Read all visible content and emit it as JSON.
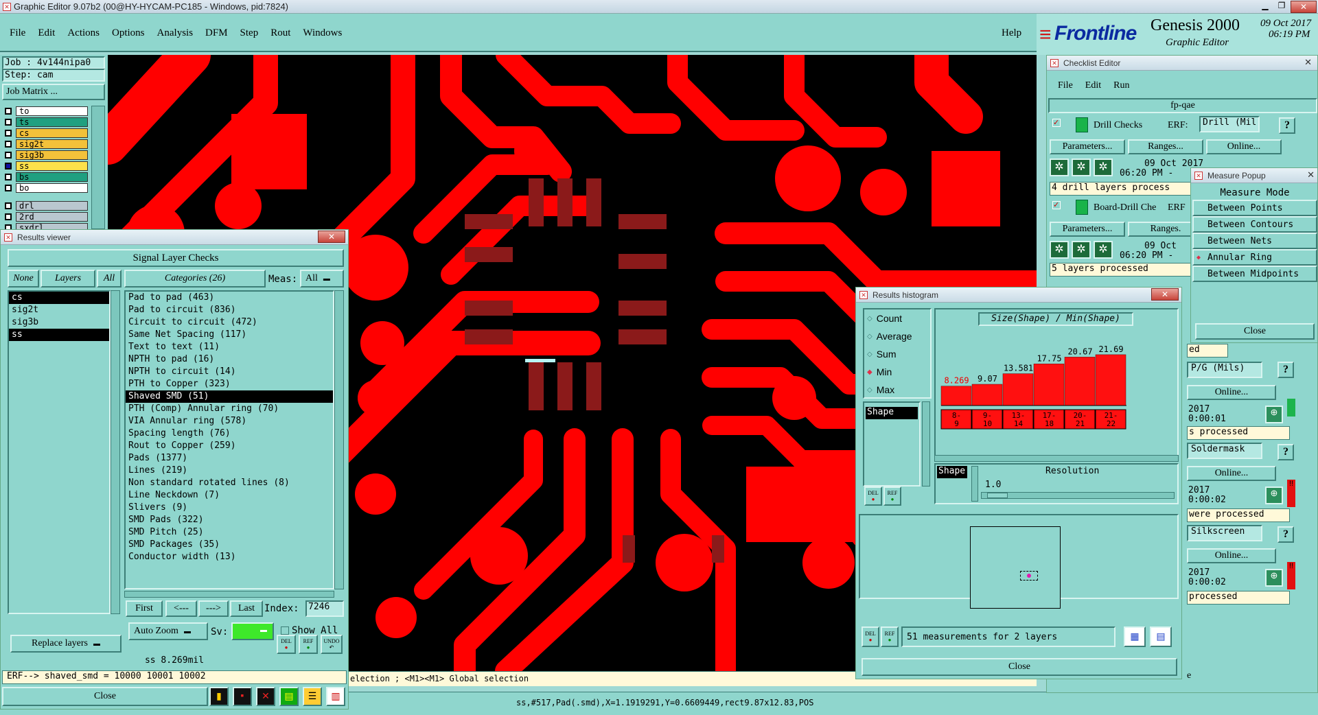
{
  "app": {
    "title": "Graphic Editor 9.07b2 (00@HY-HYCAM-PC185 - Windows, pid:7824)",
    "menus": [
      "File",
      "Edit",
      "Actions",
      "Options",
      "Analysis",
      "DFM",
      "Step",
      "Rout",
      "Windows"
    ],
    "help": "Help",
    "brand": "Frontline",
    "product": "Genesis 2000",
    "subtitle": "Graphic Editor",
    "date": "09 Oct 2017",
    "time": "06:19 PM"
  },
  "job": {
    "job": "Job : 4v144nipa0",
    "step": "Step: cam",
    "matrix": "Job Matrix ..."
  },
  "layers": [
    {
      "name": "to",
      "color": "#ffffff"
    },
    {
      "name": "ts",
      "color": "#20a080"
    },
    {
      "name": "cs",
      "color": "#f3c13a"
    },
    {
      "name": "sig2t",
      "color": "#f3c13a"
    },
    {
      "name": "sig3b",
      "color": "#f3c13a"
    },
    {
      "name": "ss",
      "color": "#f3c13a"
    },
    {
      "name": "bs",
      "color": "#20a080"
    },
    {
      "name": "bo",
      "color": "#ffffff"
    },
    {
      "name": "drl",
      "color": "#b9c7cf"
    },
    {
      "name": "2rd",
      "color": "#b9c7cf"
    },
    {
      "name": "sxdrl",
      "color": "#b9c7cf"
    }
  ],
  "results": {
    "title": "Results viewer",
    "header": "Signal Layer Checks",
    "none": "None",
    "layers_lbl": "Layers",
    "all": "All",
    "categories_lbl": "Categories (26)",
    "meas_lbl": "Meas:",
    "meas_val": "All",
    "layer_items": [
      "cs",
      "sig2t",
      "sig3b",
      "ss"
    ],
    "categories": [
      "Pad to pad (463)",
      "Pad to circuit (836)",
      "Circuit to circuit (472)",
      "Same Net Spacing (117)",
      "Text to text (11)",
      "NPTH to pad (16)",
      "NPTH to circuit (14)",
      "PTH to Copper (323)",
      "Shaved SMD (51)",
      "PTH (Comp) Annular ring (70)",
      "VIA Annular ring (578)",
      "Spacing length (76)",
      "Rout to Copper (259)",
      "Pads (1377)",
      "Lines (219)",
      "Non standard rotated lines (8)",
      "Line Neckdown (7)",
      "Slivers (9)",
      "SMD Pads (322)",
      "SMD Pitch (25)",
      "SMD Packages (35)",
      "Conductor width (13)"
    ],
    "first": "First",
    "prev": "<---",
    "next": "--->",
    "last": "Last",
    "index_lbl": "Index:",
    "index_val": "7246",
    "auto_zoom": "Auto Zoom",
    "sv": "Sv:",
    "show_all": "Show All",
    "replace": "Replace layers",
    "meas_readout": "ss 8.269mil",
    "erf": "ERF--> shaved_smd = 10000 10001 10002",
    "close": "Close",
    "del": "DEL",
    "ref": "REF",
    "undo": "UNDO"
  },
  "checklist": {
    "title": "Checklist Editor",
    "menus": [
      "File",
      "Edit",
      "Run"
    ],
    "name": "fp-qae",
    "drill": {
      "label": "Drill Checks",
      "erf": "ERF:",
      "erf_val": "Drill (Mil",
      "params": "Parameters...",
      "ranges": "Ranges...",
      "online": "Online...",
      "date": "09 Oct 2017",
      "time": "06:20 PM -",
      "status": "4 drill layers process"
    },
    "board": {
      "label": "Board-Drill Che",
      "erf": "ERF",
      "params": "Parameters...",
      "ranges": "Ranges.",
      "date": "09 Oct",
      "time": "06:20 PM -",
      "status": "5 layers processed"
    },
    "r3": {
      "erf_val": "P/G (Mils)",
      "online": "Online...",
      "date": "2017",
      "time": "0:00:01",
      "status": "s processed"
    },
    "r4": {
      "erf_val": "Soldermask",
      "online": "Online...",
      "date": "2017",
      "time": "0:00:02",
      "status": "were processed"
    },
    "r5": {
      "erf_val": "Silkscreen",
      "online": "Online...",
      "date": "2017",
      "time": "0:00:02",
      "status": "processed"
    },
    "ed": "ed",
    "e": "e",
    "q": "?"
  },
  "measure": {
    "title": "Measure Popup",
    "header": "Measure Mode",
    "items": [
      "Between Points",
      "Between Contours",
      "Between Nets",
      "Annular Ring",
      "Between Midpoints"
    ],
    "selected": 3,
    "close": "Close"
  },
  "histogram": {
    "title": "Results histogram",
    "options": [
      "Count",
      "Average",
      "Sum",
      "Min",
      "Max"
    ],
    "selected": 3,
    "chart_title": "Size(Shape) / Min(Shape)",
    "shape_item": "Shape",
    "shape_lbl": "Shape",
    "resolution_lbl": "Resolution",
    "resolution_val": "1.0",
    "status": "51 measurements for 2 layers",
    "close": "Close",
    "del": "DEL",
    "ref": "REF"
  },
  "chart_data": {
    "type": "bar",
    "title": "Size(Shape) / Min(Shape)",
    "categories": [
      "8-9",
      "9-10",
      "13-14",
      "17-18",
      "20-21",
      "21-22"
    ],
    "values": [
      8.269,
      9.07,
      13.581,
      17.75,
      20.67,
      21.69
    ],
    "value_labels": [
      "8.269",
      "9.07",
      "13.581",
      "17.75",
      "20.67",
      "21.69"
    ],
    "cat_labels": [
      [
        "8-",
        "9"
      ],
      [
        "9-",
        "10"
      ],
      [
        "13-",
        "14"
      ],
      [
        "17-",
        "18"
      ],
      [
        "20-",
        "21"
      ],
      [
        "21-",
        "22"
      ]
    ],
    "bar_color": "#ff1010",
    "ylim": [
      0,
      24
    ]
  },
  "statusbar": {
    "hint": "election ; <M1><M1> Global selection",
    "coords": "ss,#517,Pad(.smd),X=1.1919291,Y=0.6609449,rect9.87x12.83,POS"
  }
}
